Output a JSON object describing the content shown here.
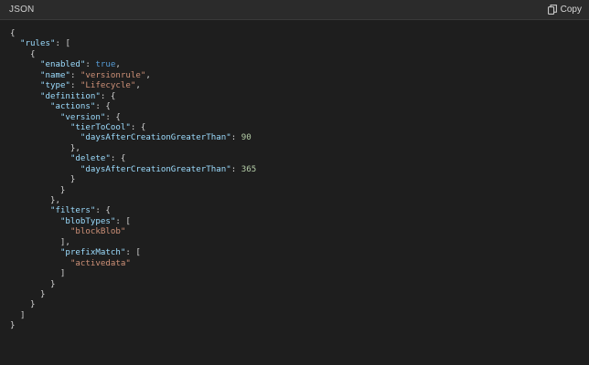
{
  "header": {
    "language_label": "JSON",
    "copy_label": "Copy"
  },
  "code_lines": [
    [
      {
        "t": "p",
        "v": "{"
      }
    ],
    [
      {
        "t": "p",
        "v": "  "
      },
      {
        "t": "k",
        "v": "\"rules\""
      },
      {
        "t": "p",
        "v": ": ["
      }
    ],
    [
      {
        "t": "p",
        "v": "    {"
      }
    ],
    [
      {
        "t": "p",
        "v": "      "
      },
      {
        "t": "k",
        "v": "\"enabled\""
      },
      {
        "t": "p",
        "v": ": "
      },
      {
        "t": "b",
        "v": "true"
      },
      {
        "t": "p",
        "v": ","
      }
    ],
    [
      {
        "t": "p",
        "v": "      "
      },
      {
        "t": "k",
        "v": "\"name\""
      },
      {
        "t": "p",
        "v": ": "
      },
      {
        "t": "s",
        "v": "\"versionrule\""
      },
      {
        "t": "p",
        "v": ","
      }
    ],
    [
      {
        "t": "p",
        "v": "      "
      },
      {
        "t": "k",
        "v": "\"type\""
      },
      {
        "t": "p",
        "v": ": "
      },
      {
        "t": "s",
        "v": "\"Lifecycle\""
      },
      {
        "t": "p",
        "v": ","
      }
    ],
    [
      {
        "t": "p",
        "v": "      "
      },
      {
        "t": "k",
        "v": "\"definition\""
      },
      {
        "t": "p",
        "v": ": {"
      }
    ],
    [
      {
        "t": "p",
        "v": "        "
      },
      {
        "t": "k",
        "v": "\"actions\""
      },
      {
        "t": "p",
        "v": ": {"
      }
    ],
    [
      {
        "t": "p",
        "v": "          "
      },
      {
        "t": "k",
        "v": "\"version\""
      },
      {
        "t": "p",
        "v": ": {"
      }
    ],
    [
      {
        "t": "p",
        "v": "            "
      },
      {
        "t": "k",
        "v": "\"tierToCool\""
      },
      {
        "t": "p",
        "v": ": {"
      }
    ],
    [
      {
        "t": "p",
        "v": "              "
      },
      {
        "t": "k",
        "v": "\"daysAfterCreationGreaterThan\""
      },
      {
        "t": "p",
        "v": ": "
      },
      {
        "t": "n",
        "v": "90"
      }
    ],
    [
      {
        "t": "p",
        "v": "            },"
      }
    ],
    [
      {
        "t": "p",
        "v": "            "
      },
      {
        "t": "k",
        "v": "\"delete\""
      },
      {
        "t": "p",
        "v": ": {"
      }
    ],
    [
      {
        "t": "p",
        "v": "              "
      },
      {
        "t": "k",
        "v": "\"daysAfterCreationGreaterThan\""
      },
      {
        "t": "p",
        "v": ": "
      },
      {
        "t": "n",
        "v": "365"
      }
    ],
    [
      {
        "t": "p",
        "v": "            }"
      }
    ],
    [
      {
        "t": "p",
        "v": "          }"
      }
    ],
    [
      {
        "t": "p",
        "v": "        },"
      }
    ],
    [
      {
        "t": "p",
        "v": "        "
      },
      {
        "t": "k",
        "v": "\"filters\""
      },
      {
        "t": "p",
        "v": ": {"
      }
    ],
    [
      {
        "t": "p",
        "v": "          "
      },
      {
        "t": "k",
        "v": "\"blobTypes\""
      },
      {
        "t": "p",
        "v": ": ["
      }
    ],
    [
      {
        "t": "p",
        "v": "            "
      },
      {
        "t": "s",
        "v": "\"blockBlob\""
      }
    ],
    [
      {
        "t": "p",
        "v": "          ],"
      }
    ],
    [
      {
        "t": "p",
        "v": "          "
      },
      {
        "t": "k",
        "v": "\"prefixMatch\""
      },
      {
        "t": "p",
        "v": ": ["
      }
    ],
    [
      {
        "t": "p",
        "v": "            "
      },
      {
        "t": "s",
        "v": "\"activedata\""
      }
    ],
    [
      {
        "t": "p",
        "v": "          ]"
      }
    ],
    [
      {
        "t": "p",
        "v": "        }"
      }
    ],
    [
      {
        "t": "p",
        "v": "      }"
      }
    ],
    [
      {
        "t": "p",
        "v": "    }"
      }
    ],
    [
      {
        "t": "p",
        "v": "  ]"
      }
    ],
    [
      {
        "t": "p",
        "v": "}"
      }
    ]
  ]
}
